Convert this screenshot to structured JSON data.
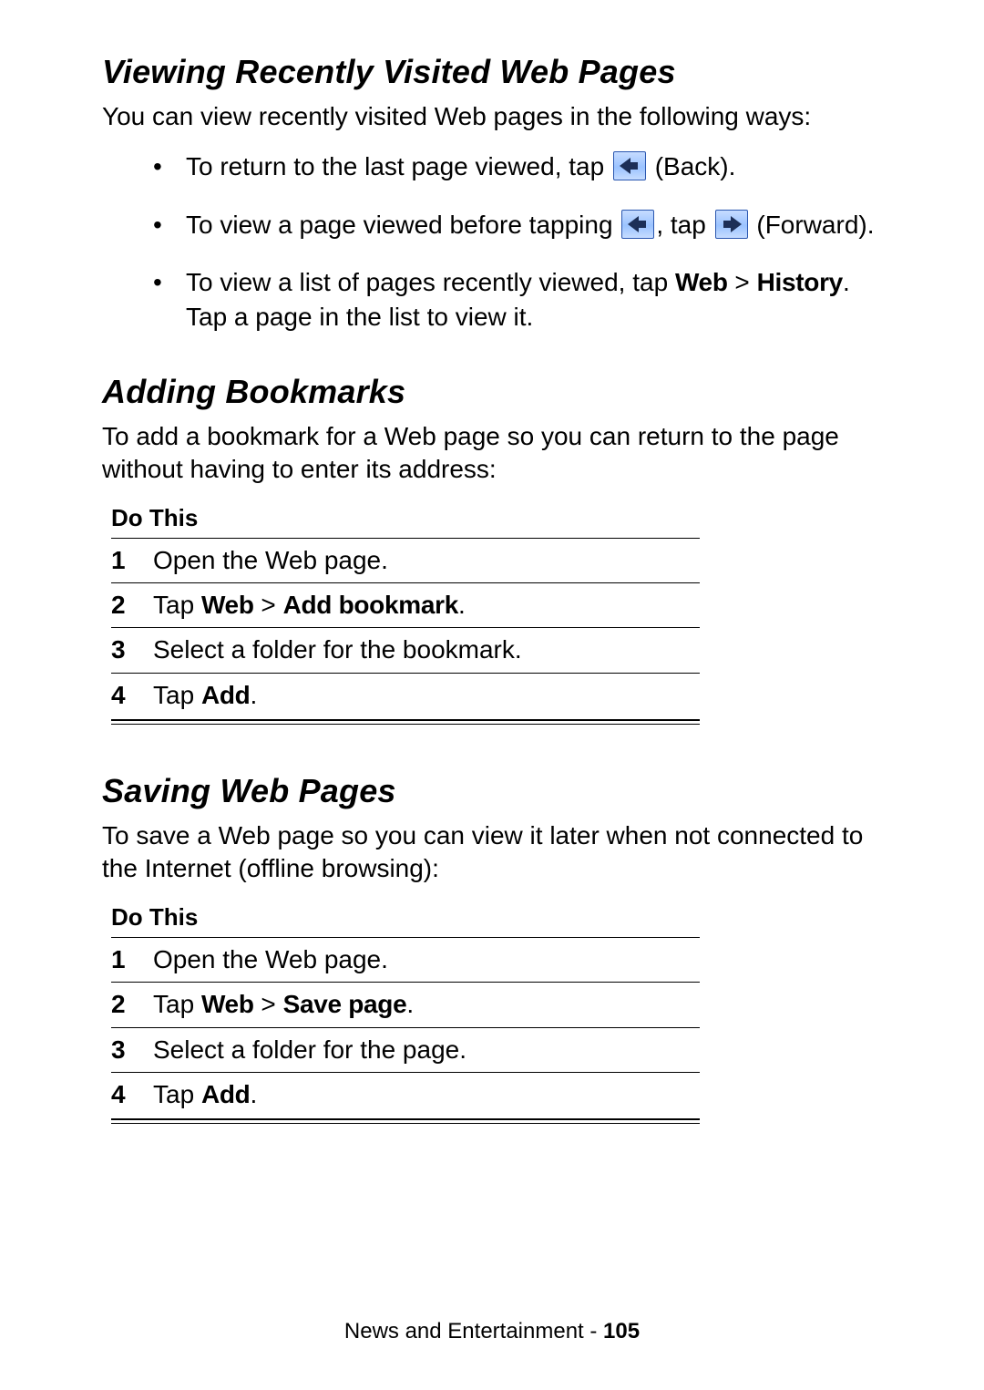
{
  "section1": {
    "title": "Viewing Recently Visited Web Pages",
    "intro": "You can view recently visited Web pages in the following ways:",
    "bullets": {
      "b1_pre": "To return to the last page viewed, tap ",
      "b1_post": " (Back).",
      "b2_pre": "To view a page viewed before tapping ",
      "b2_mid": ", tap ",
      "b2_post": " (Forward).",
      "b3_pre": "To view a list of pages recently viewed, tap ",
      "b3_menu1": "Web",
      "b3_gt": " > ",
      "b3_menu2": "History",
      "b3_post": ". Tap a page in the list to view it."
    }
  },
  "section2": {
    "title": "Adding Bookmarks",
    "intro": "To add a bookmark for a Web page so you can return to the page without having to enter its address:",
    "table_header": "Do This",
    "steps": [
      {
        "n": "1",
        "pre": "Open the Web page."
      },
      {
        "n": "2",
        "pre": "Tap ",
        "b1": "Web",
        "gt": " > ",
        "b2": "Add bookmark",
        "post": "."
      },
      {
        "n": "3",
        "pre": "Select a folder for the bookmark."
      },
      {
        "n": "4",
        "pre": "Tap ",
        "b1": "Add",
        "post": "."
      }
    ]
  },
  "section3": {
    "title": "Saving Web Pages",
    "intro": "To save a Web page so you can view it later when not connected to the Internet (offline browsing):",
    "table_header": "Do This",
    "steps": [
      {
        "n": "1",
        "pre": "Open the Web page."
      },
      {
        "n": "2",
        "pre": "Tap ",
        "b1": "Web",
        "gt": " > ",
        "b2": "Save page",
        "post": "."
      },
      {
        "n": "3",
        "pre": "Select a folder for the page."
      },
      {
        "n": "4",
        "pre": "Tap ",
        "b1": "Add",
        "post": "."
      }
    ]
  },
  "footer": {
    "chapter": "News and Entertainment - ",
    "page": "105"
  }
}
